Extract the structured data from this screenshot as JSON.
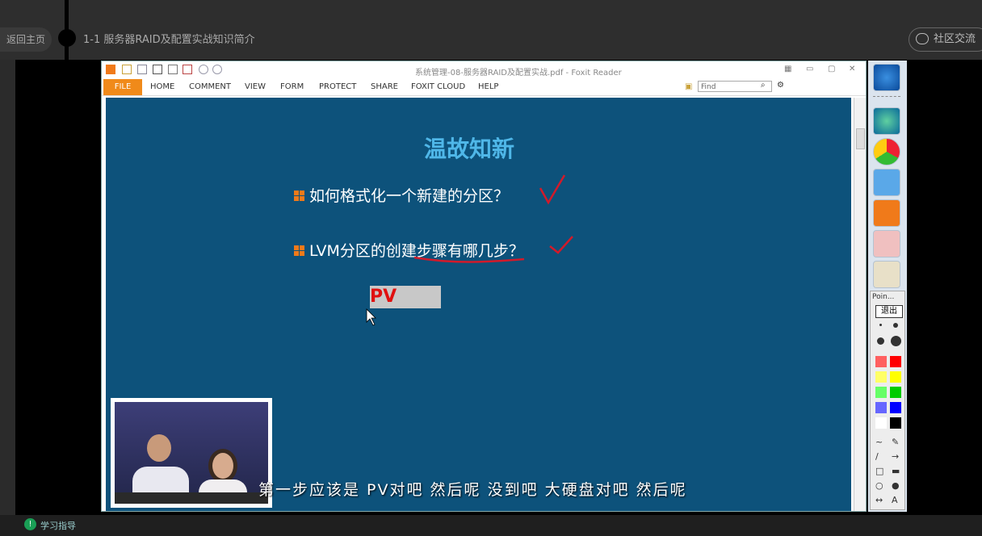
{
  "page": {
    "back_label": "返回主页",
    "lesson_title": "1-1 服务器RAID及配置实战知识简介",
    "community_label": "社区交流",
    "guide_label": "学习指导"
  },
  "reader": {
    "window_title": "系统管理-08-服务器RAID及配置实战.pdf - Foxit Reader",
    "menu": [
      "FILE",
      "HOME",
      "COMMENT",
      "VIEW",
      "FORM",
      "PROTECT",
      "SHARE",
      "FOXIT CLOUD",
      "HELP"
    ],
    "find_placeholder": "Find"
  },
  "slide": {
    "title": "温故知新",
    "bullets": [
      "如何格式化一个新建的分区？",
      "LVM分区的创建步骤有哪几步？"
    ],
    "answer": "PV"
  },
  "subtitle": "第一步应该是 PV对吧 然后呢 没到吧 大硬盘对吧 然后呢",
  "pointer_panel": {
    "title": "Poin...",
    "exit_label": "退出",
    "colors": [
      "#ff6060",
      "#ff0000",
      "#ffff66",
      "#ffff00",
      "#66ff66",
      "#00cc00",
      "#6666ff",
      "#0000ff",
      "#ffffff",
      "#000000"
    ],
    "tools": [
      "~",
      "✎",
      "/",
      "→",
      "□",
      "▬",
      "○",
      "●",
      "↔",
      "A"
    ]
  },
  "icons": [
    "windows-start-icon",
    "app-icon",
    "chrome-icon",
    "window-icon",
    "foxit-icon",
    "pen-icon",
    "pointer-tool-icon"
  ]
}
